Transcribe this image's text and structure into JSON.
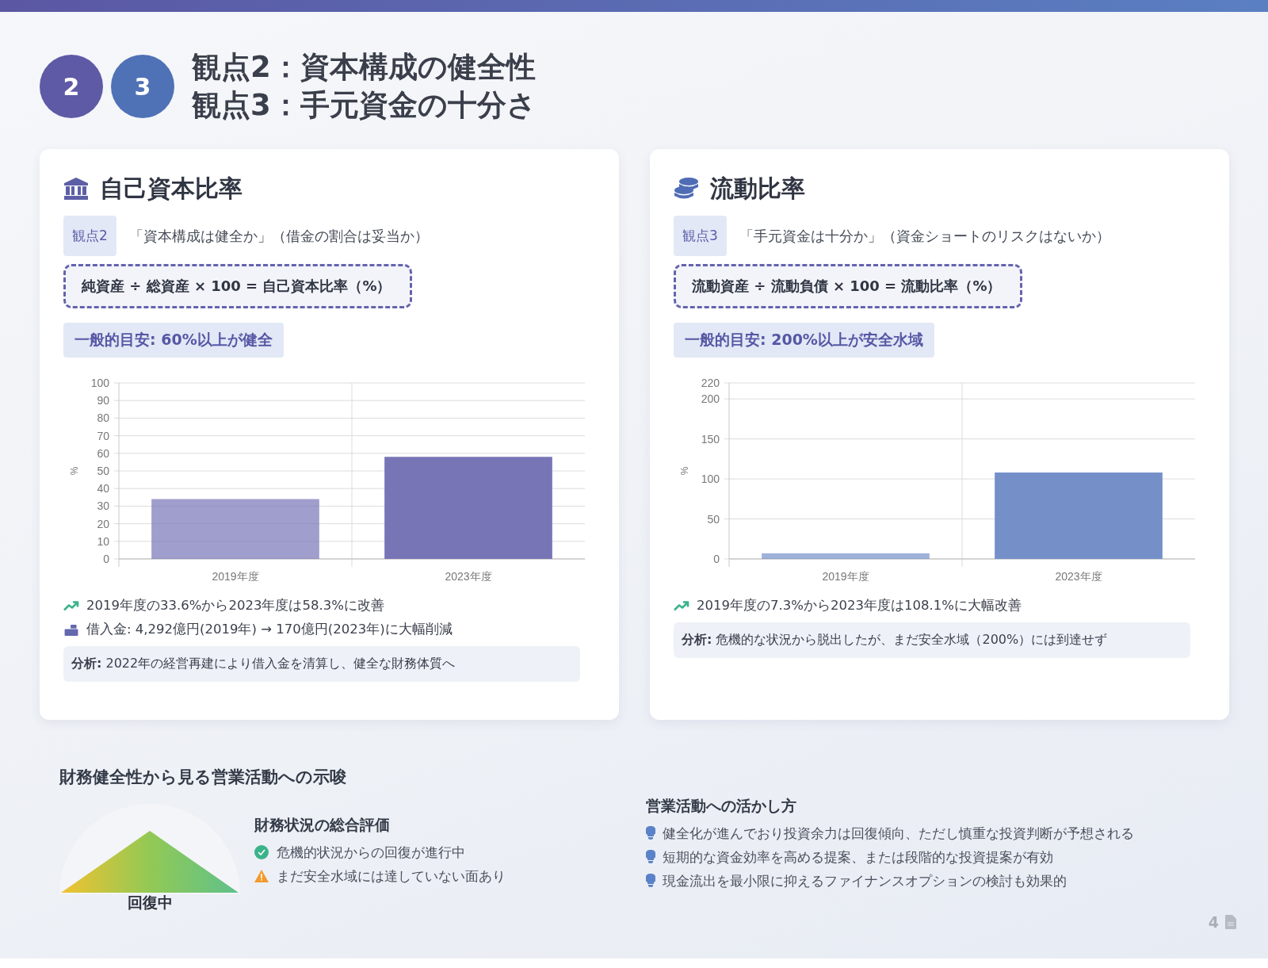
{
  "header": {
    "badges": [
      "2",
      "3"
    ],
    "title_lines": [
      "観点2：資本構成の健全性",
      "観点3：手元資金の十分さ"
    ]
  },
  "cards": [
    {
      "kind": "equity",
      "title": "自己資本比率",
      "tag": "観点2",
      "question": "「資本構成は健全か」（借金の割合は妥当か）",
      "formula": "純資産 ÷ 総資産 × 100 = 自己資本比率（%）",
      "guideline": "一般的目安: 60%以上が健全",
      "chart_data": {
        "type": "bar",
        "ylabel": "%",
        "categories": [
          "2019年度",
          "2023年度"
        ],
        "series": [
          {
            "color": "#7875b6",
            "values": [
              34,
              58
            ]
          }
        ],
        "grid": true,
        "ylim": [
          0,
          100
        ],
        "yticks": [
          0,
          10,
          20,
          30,
          40,
          50,
          60,
          70,
          80,
          90,
          100
        ]
      },
      "points": [
        {
          "kind": "trend",
          "text": "2019年度の33.6%から2023年度は58.3%に改善"
        },
        {
          "kind": "debt",
          "text": "借入金: 4,292億円(2019年) → 170億円(2023年)に大幅削減"
        }
      ],
      "analysis": "**分析:** 2022年の経営再建により借入金を清算し、健全な財務体質へ"
    },
    {
      "kind": "liquidity",
      "title": "流動比率",
      "tag": "観点3",
      "question": "「手元資金は十分か」（資金ショートのリスクはないか）",
      "formula": "流動資産 ÷ 流動負債 × 100 = 流動比率（%）",
      "guideline": "一般的目安: 200%以上が安全水域",
      "chart_data": {
        "type": "bar",
        "ylabel": "%",
        "categories": [
          "2019年度",
          "2023年度"
        ],
        "series": [
          {
            "color": "#7590c9",
            "values": [
              7,
              108
            ]
          }
        ],
        "grid": true,
        "ylim": [
          0,
          220
        ],
        "yticks": [
          0,
          50,
          100,
          150,
          200,
          220
        ]
      },
      "points": [
        {
          "kind": "trend",
          "text": "2019年度の7.3%から2023年度は108.1%に大幅改善"
        }
      ],
      "analysis": "**分析:** 危機的な状況から脱出したが、まだ安全水域（200%）には到達せず"
    }
  ],
  "implications": {
    "title": "財務健全性から見る営業活動への示唆",
    "gauge_label": "回復中",
    "evaluation": {
      "title": "財務状況の総合評価",
      "items": [
        {
          "kind": "ok",
          "text": "危機的状況からの回復が進行中"
        },
        {
          "kind": "warning",
          "text": "まだ安全水域には達していない面あり"
        }
      ]
    },
    "usage": {
      "title": "営業活動への活かし方",
      "items": [
        "健全化が進んでおり投資余力は回復傾向、ただし慎重な投資判断が予想される",
        "短期的な資金効率を高める提案、または段階的な投資提案が有効",
        "現金流出を最小限に抑えるファイナンスオプションの検討も効果的"
      ]
    }
  },
  "page_number": "4"
}
